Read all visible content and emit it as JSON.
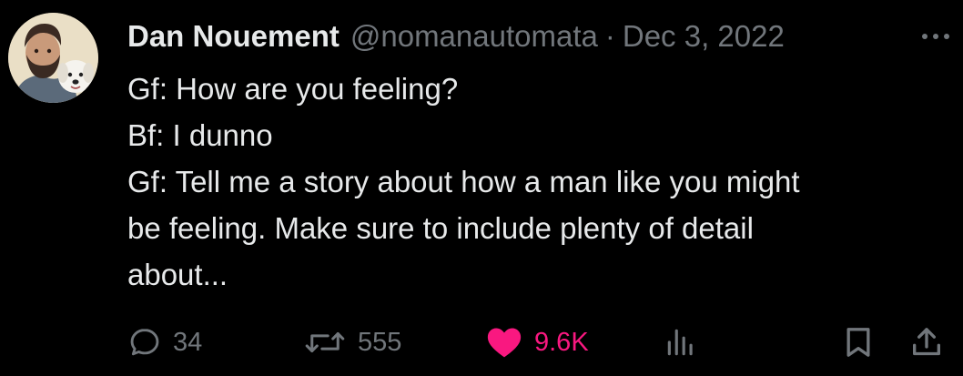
{
  "tweet": {
    "author": {
      "name": "Dan Nouement",
      "handle": "@nomanautomata"
    },
    "separator": "·",
    "date": "Dec 3, 2022",
    "lines": [
      "Gf: How are you feeling?",
      "Bf: I dunno",
      "Gf: Tell me a story about how a man like you might",
      "be feeling. Make sure to include plenty of detail",
      "about..."
    ],
    "actions": {
      "replies": "34",
      "retweets": "555",
      "likes": "9.6K"
    }
  },
  "colors": {
    "background": "#000000",
    "text": "#e7e9ea",
    "muted": "#71767b",
    "like": "#f91880"
  },
  "icons": {
    "more": "more-dots-icon",
    "reply": "reply-bubble-icon",
    "retweet": "retweet-arrows-icon",
    "like": "heart-filled-icon",
    "views": "views-bars-icon",
    "bookmark": "bookmark-icon",
    "share": "share-upload-icon"
  }
}
